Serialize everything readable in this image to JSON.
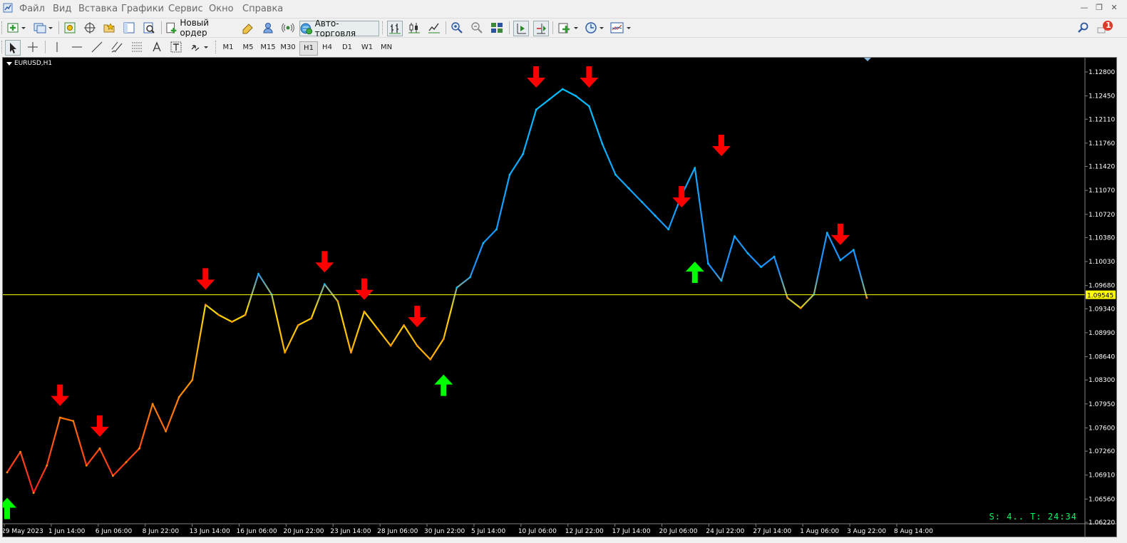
{
  "menu": {
    "items": [
      "Файл",
      "Вид",
      "Вставка",
      "Графики",
      "Сервис",
      "Окно",
      "Справка"
    ]
  },
  "toolbar": {
    "new_order_label": "Новый ордер",
    "autotrade_label": "Авто-торговля",
    "notification_count": "1"
  },
  "timeframes": [
    "M1",
    "M5",
    "M15",
    "M30",
    "H1",
    "H4",
    "D1",
    "W1",
    "MN"
  ],
  "active_timeframe": "H1",
  "chart": {
    "symbol_title": "EURUSD,H1",
    "current_price": "1.09545",
    "status_readout": "S: 4.. T: 24:34",
    "background": "#000000",
    "price_line_color": "#ffff00",
    "axis_text_color": "#ffffff",
    "sell_signal_color": "#ff0000",
    "buy_signal_color": "#00ff00",
    "line_gradient_colors": [
      "#0000ff",
      "#00bfff",
      "#ffff00",
      "#ff8c00",
      "#ff0000"
    ]
  },
  "chart_data": {
    "type": "line",
    "y_ticks": [
      "1.12800",
      "1.12450",
      "1.12110",
      "1.11760",
      "1.11420",
      "1.11070",
      "1.10720",
      "1.10380",
      "1.10030",
      "1.09680",
      "1.09340",
      "1.08990",
      "1.08640",
      "1.08300",
      "1.07950",
      "1.07600",
      "1.07260",
      "1.06910",
      "1.06560",
      "1.06220"
    ],
    "x_ticks": [
      "29 May 2023",
      "1 Jun 14:00",
      "6 Jun 06:00",
      "8 Jun 22:00",
      "13 Jun 14:00",
      "16 Jun 06:00",
      "20 Jun 22:00",
      "23 Jun 14:00",
      "28 Jun 06:00",
      "30 Jun 22:00",
      "5 Jul 14:00",
      "10 Jul 06:00",
      "12 Jul 22:00",
      "17 Jul 14:00",
      "20 Jul 06:00",
      "24 Jul 22:00",
      "27 Jul 14:00",
      "1 Aug 06:00",
      "3 Aug 22:00",
      "8 Aug 14:00"
    ],
    "ylim": [
      1.0622,
      1.128
    ],
    "series": [
      {
        "points": [
          [
            0,
            1.0695
          ],
          [
            1,
            1.0725
          ],
          [
            2,
            1.0665
          ],
          [
            3,
            1.0705
          ],
          [
            4,
            1.0775
          ],
          [
            5,
            1.077
          ],
          [
            6,
            1.0705
          ],
          [
            7,
            1.073
          ],
          [
            8,
            1.069
          ],
          [
            9,
            1.071
          ],
          [
            10,
            1.073
          ],
          [
            11,
            1.0795
          ],
          [
            12,
            1.0755
          ],
          [
            13,
            1.0805
          ],
          [
            14,
            1.083
          ],
          [
            15,
            1.094
          ],
          [
            16,
            1.0925
          ],
          [
            17,
            1.0915
          ],
          [
            18,
            1.0925
          ],
          [
            19,
            1.0985
          ],
          [
            20,
            1.0955
          ],
          [
            21,
            1.087
          ],
          [
            22,
            1.091
          ],
          [
            23,
            1.092
          ],
          [
            24,
            1.097
          ],
          [
            25,
            1.0945
          ],
          [
            26,
            1.087
          ],
          [
            27,
            1.093
          ],
          [
            28,
            1.0905
          ],
          [
            29,
            1.088
          ],
          [
            30,
            1.091
          ],
          [
            31,
            1.088
          ],
          [
            32,
            1.086
          ],
          [
            33,
            1.089
          ],
          [
            34,
            1.0965
          ],
          [
            35,
            1.098
          ],
          [
            36,
            1.103
          ],
          [
            37,
            1.105
          ],
          [
            38,
            1.113
          ],
          [
            39,
            1.116
          ],
          [
            40,
            1.1225
          ],
          [
            41,
            1.124
          ],
          [
            42,
            1.1255
          ],
          [
            43,
            1.1245
          ],
          [
            44,
            1.123
          ],
          [
            45,
            1.1175
          ],
          [
            46,
            1.113
          ],
          [
            47,
            1.111
          ],
          [
            48,
            1.109
          ],
          [
            49,
            1.107
          ],
          [
            50,
            1.105
          ],
          [
            51,
            1.11
          ],
          [
            52,
            1.114
          ],
          [
            53,
            1.1
          ],
          [
            54,
            1.0975
          ],
          [
            55,
            1.104
          ],
          [
            56,
            1.1015
          ],
          [
            57,
            1.0995
          ],
          [
            58,
            1.101
          ],
          [
            59,
            1.095
          ],
          [
            60,
            1.0935
          ],
          [
            61,
            1.0955
          ],
          [
            62,
            1.1045
          ],
          [
            63,
            1.1005
          ],
          [
            64,
            1.102
          ],
          [
            65,
            1.095
          ]
        ]
      }
    ],
    "signals": [
      {
        "type": "buy",
        "i": 0,
        "y": 1.066
      },
      {
        "type": "sell",
        "i": 4,
        "y": 1.079
      },
      {
        "type": "sell",
        "i": 7,
        "y": 1.0745
      },
      {
        "type": "sell",
        "i": 15,
        "y": 1.096
      },
      {
        "type": "sell",
        "i": 24,
        "y": 1.0985
      },
      {
        "type": "sell",
        "i": 27,
        "y": 1.0945
      },
      {
        "type": "sell",
        "i": 31,
        "y": 1.0905
      },
      {
        "type": "buy",
        "i": 33,
        "y": 1.084
      },
      {
        "type": "sell",
        "i": 40,
        "y": 1.1255
      },
      {
        "type": "sell",
        "i": 44,
        "y": 1.1255
      },
      {
        "type": "sell",
        "i": 51,
        "y": 1.108
      },
      {
        "type": "buy",
        "i": 52,
        "y": 1.1005
      },
      {
        "type": "sell",
        "i": 54,
        "y": 1.1155
      },
      {
        "type": "sell",
        "i": 63,
        "y": 1.1025
      }
    ]
  }
}
